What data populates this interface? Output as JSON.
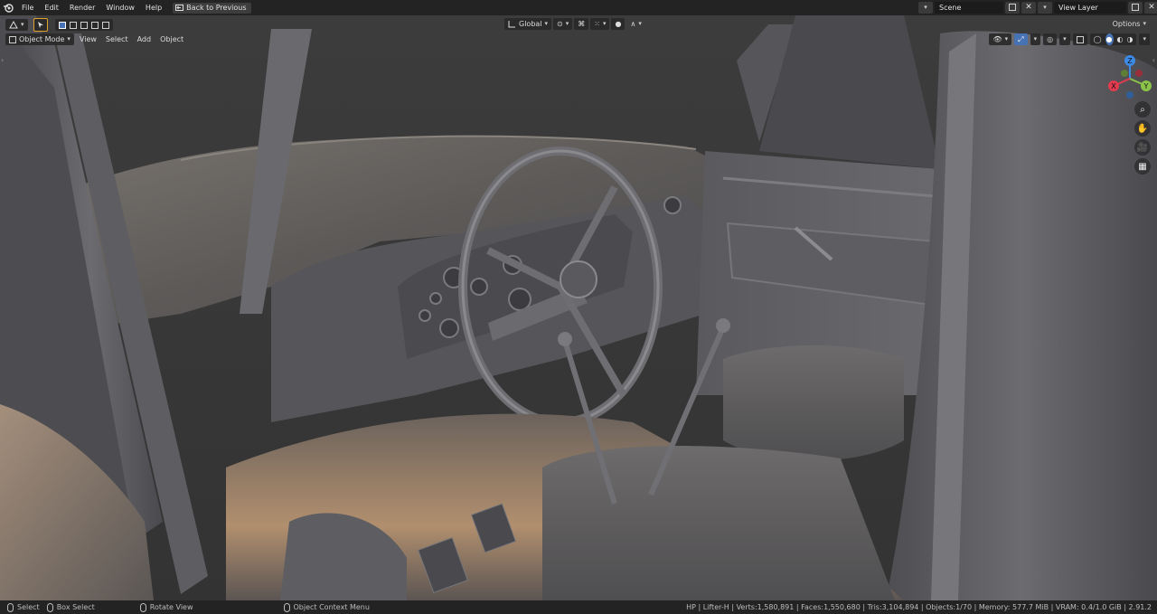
{
  "menubar": {
    "items": [
      "File",
      "Edit",
      "Render",
      "Window",
      "Help"
    ],
    "back_button": "Back to Previous",
    "scene_value": "Scene",
    "view_layer_value": "View Layer"
  },
  "viewport_header": {
    "mode": "Object Mode",
    "menus": [
      "View",
      "Select",
      "Add",
      "Object"
    ],
    "transform_orientation": "Global",
    "options_label": "Options"
  },
  "gizmo": {
    "x": "X",
    "y": "Y",
    "z": "Z",
    "colors": {
      "x": "#e23b4e",
      "y": "#8bc34a",
      "z": "#3b8ae6"
    }
  },
  "statusbar": {
    "select": "Select",
    "box_select": "Box Select",
    "rotate_view": "Rotate View",
    "context_menu": "Object Context Menu",
    "stats": "HP | Lifter-H | Verts:1,580,891 | Faces:1,550,680 | Tris:3,104,894 | Objects:1/70 | Memory: 577.7 MiB | VRAM: 0.4/1.0 GiB | 2.91.2"
  },
  "colors": {
    "accent": "#4772b3",
    "header_bg": "#232323",
    "viewport_bg": "#3a3a3a"
  }
}
